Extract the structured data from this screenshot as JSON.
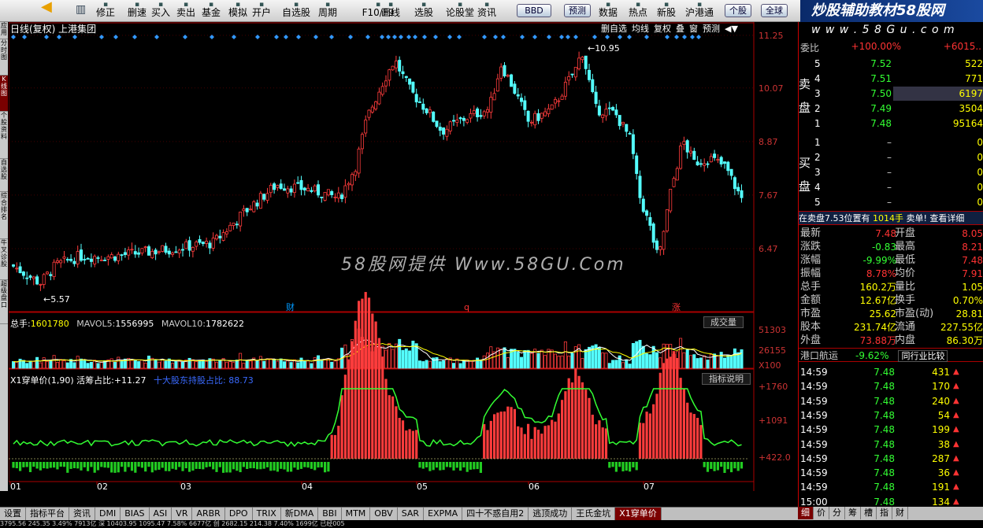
{
  "toolbar": {
    "buttons": [
      "修正",
      "删速",
      "买入",
      "卖出",
      "基金",
      "模拟",
      "开户",
      "自选股",
      "周期",
      "F10/F9",
      "画线",
      "选股",
      "论股堂",
      "资讯",
      "BBD",
      "预测",
      "数据",
      "热点",
      "新股",
      "沪港通",
      "个股",
      "全球"
    ],
    "brand": "炒股辅助教材58股网",
    "brand_url": "w w w . 5 8 G u . c o m"
  },
  "left_tabs": [
    "应用",
    "分时图",
    "K线图",
    "个股资料",
    "自选股",
    "综合排名",
    "牛叉诊股",
    "超级盘口"
  ],
  "chart": {
    "title": "日线(复权) 上港集团",
    "tools": [
      "删自选",
      "均线",
      "复权",
      "叠",
      "窗",
      "预测"
    ],
    "price_axis": [
      "11.25",
      "10.07",
      "8.87",
      "7.67",
      "6.47"
    ],
    "high_label": "10.95",
    "low_label": "5.57",
    "watermark": "58股网提供 Www.58GU.Com",
    "event_marks": [
      "财",
      "q",
      "涨"
    ],
    "volume": {
      "label_total": "总手:",
      "total": "1601780",
      "ma5_label": "MAVOL5:",
      "ma5": "1556995",
      "ma10_label": "MAVOL10:",
      "ma10": "1782622",
      "button": "成交量",
      "axis": [
        "51303",
        "26155",
        "X100"
      ]
    },
    "indicator": {
      "title": "X1穿单价(1,90) 活筹占比:",
      "value": "+11.27",
      "sub_label": "十大股东持股占比: 88.73",
      "button": "指标说明",
      "axis": [
        "+1760",
        "+1091",
        "+422.0"
      ]
    },
    "months": [
      "01",
      "02",
      "03",
      "04",
      "05",
      "06",
      "07"
    ]
  },
  "chart_data": {
    "type": "candlestick",
    "price_range": [
      5.2,
      11.3
    ],
    "ticks": [
      11.25,
      10.07,
      8.87,
      7.67,
      6.47
    ],
    "high": 10.95,
    "low": 5.57
  },
  "order_book": {
    "top_label": "委比",
    "top_value": "+100.00%",
    "top_right": "+6015..",
    "sell_label": "卖盘",
    "buy_label": "买盘",
    "sells": [
      {
        "n": "5",
        "p": "7.52",
        "v": "522"
      },
      {
        "n": "4",
        "p": "7.51",
        "v": "771"
      },
      {
        "n": "3",
        "p": "7.50",
        "v": "6197"
      },
      {
        "n": "2",
        "p": "7.49",
        "v": "3504"
      },
      {
        "n": "1",
        "p": "7.48",
        "v": "95164"
      }
    ],
    "buys": [
      {
        "n": "1",
        "p": "–",
        "v": "0"
      },
      {
        "n": "2",
        "p": "–",
        "v": "0"
      },
      {
        "n": "3",
        "p": "–",
        "v": "0"
      },
      {
        "n": "4",
        "p": "–",
        "v": "0"
      },
      {
        "n": "5",
        "p": "–",
        "v": "0"
      }
    ],
    "notice": "在卖盘7.53位置有",
    "notice_qty": "1014手",
    "notice_link": "卖单! 查看详细"
  },
  "stats": [
    {
      "l": "最新",
      "v": "7.48",
      "l2": "开盘",
      "v2": "8.05"
    },
    {
      "l": "涨跌",
      "v": "-0.83",
      "l2": "最高",
      "v2": "8.21"
    },
    {
      "l": "涨幅",
      "v": "-9.99%",
      "l2": "最低",
      "v2": "7.48"
    },
    {
      "l": "振幅",
      "v": "8.78%",
      "l2": "均价",
      "v2": "7.91"
    },
    {
      "l": "总手",
      "v": "160.2万",
      "l2": "量比",
      "v2": "1.05"
    },
    {
      "l": "金额",
      "v": "12.67亿",
      "l2": "换手",
      "v2": "0.70%"
    },
    {
      "l": "市盈",
      "v": "25.62",
      "l2": "市盈(动)",
      "v2": "28.81"
    },
    {
      "l": "股本",
      "v": "231.74亿",
      "l2": "流通",
      "v2": "227.55亿"
    },
    {
      "l": "外盘",
      "v": "73.88万",
      "l2": "内盘",
      "v2": "86.30万"
    }
  ],
  "sector": {
    "name": "港口航运",
    "change": "-9.62%",
    "link": "同行业比较"
  },
  "ticks": [
    {
      "t": "14:59",
      "p": "7.48",
      "v": "431"
    },
    {
      "t": "14:59",
      "p": "7.48",
      "v": "170"
    },
    {
      "t": "14:59",
      "p": "7.48",
      "v": "240"
    },
    {
      "t": "14:59",
      "p": "7.48",
      "v": "54"
    },
    {
      "t": "14:59",
      "p": "7.48",
      "v": "199"
    },
    {
      "t": "14:59",
      "p": "7.48",
      "v": "38"
    },
    {
      "t": "14:59",
      "p": "7.48",
      "v": "287"
    },
    {
      "t": "14:59",
      "p": "7.48",
      "v": "36"
    },
    {
      "t": "14:59",
      "p": "7.48",
      "v": "191"
    },
    {
      "t": "15:00",
      "p": "7.48",
      "v": "134"
    }
  ],
  "bottom_tabs": [
    "设置",
    "指标平台",
    "资讯",
    "DMI",
    "BIAS",
    "ASI",
    "VR",
    "ARBR",
    "DPO",
    "TRIX",
    "新DMA",
    "BBI",
    "MTM",
    "OBV",
    "SAR",
    "EXPMA",
    "四十不惑自用2",
    "逃顶成功",
    "王氏金坑",
    "X1穿单价"
  ],
  "right_tabs": [
    "细",
    "价",
    "分",
    "筹",
    "槽",
    "指",
    "财"
  ],
  "status": "3795.56   245.35   3.49%   7913亿 深  10403.95   1095.47   7.58%   6677亿 创   2682.15   214.38   7.40%   1699亿 已经005"
}
